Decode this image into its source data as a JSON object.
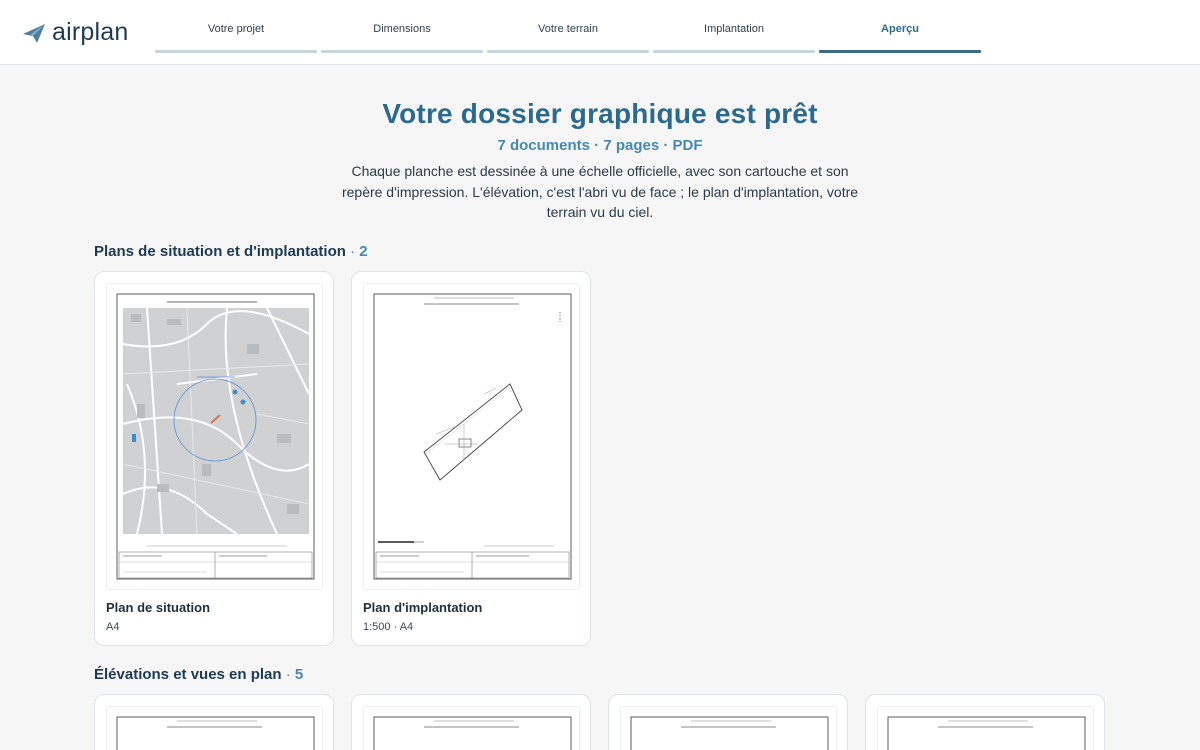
{
  "brand": {
    "name": "airplan"
  },
  "steps": [
    {
      "label": "Votre projet"
    },
    {
      "label": "Dimensions"
    },
    {
      "label": "Votre terrain"
    },
    {
      "label": "Implantation"
    },
    {
      "label": "Aperçu"
    }
  ],
  "active_step": 4,
  "hero": {
    "title": "Votre dossier graphique est prêt",
    "meta": "7 documents · 7 pages · PDF",
    "description": "Chaque planche est dessinée à une échelle officielle, avec son cartouche et son repère d'impression. L'élévation, c'est l'abri vu de face ; le plan d'implantation, votre terrain vu du ciel."
  },
  "sections": [
    {
      "title": "Plans de situation et d'implantation",
      "sep": "·",
      "count": "2",
      "cards": [
        {
          "name": "Plan de situation",
          "subtitle": "A4"
        },
        {
          "name": "Plan d'implantation",
          "subtitle": "1:500 · A4"
        }
      ]
    },
    {
      "title": "Élévations et vues en plan",
      "sep": "·",
      "count": "5",
      "cards": [
        {
          "name": "",
          "subtitle": ""
        },
        {
          "name": "",
          "subtitle": ""
        },
        {
          "name": "",
          "subtitle": ""
        },
        {
          "name": "",
          "subtitle": ""
        }
      ]
    }
  ],
  "colors": {
    "accent": "#2b6a8d",
    "accent_light": "#4789ad",
    "background": "#f6f6f7",
    "step_bar": "#c7d4dd",
    "step_bar_active": "#3b6a85"
  }
}
